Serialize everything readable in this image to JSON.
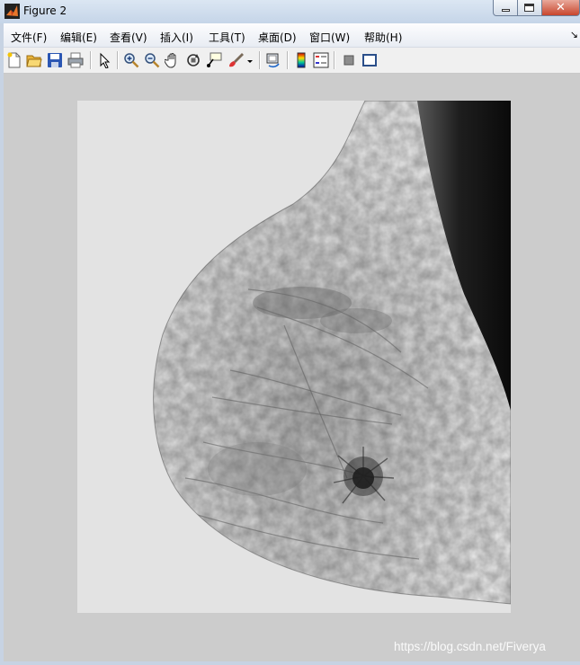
{
  "window": {
    "title": "Figure 2",
    "close_glyph": "✕"
  },
  "menu": {
    "items": [
      "文件(F)",
      "编辑(E)",
      "查看(V)",
      "插入(I)",
      "工具(T)",
      "桌面(D)",
      "窗口(W)",
      "帮助(H)"
    ],
    "overflow_glyph": "↘"
  },
  "toolbar": {
    "icons": [
      "new-figure-icon",
      "open-file-icon",
      "save-icon",
      "print-icon",
      "edit-plot-arrow-icon",
      "zoom-in-icon",
      "zoom-out-icon",
      "pan-hand-icon",
      "rotate-3d-icon",
      "data-cursor-icon",
      "brush-icon",
      "brush-dropdown-icon",
      "link-plot-icon",
      "colorbar-icon",
      "legend-icon",
      "hide-plot-tools-icon",
      "show-plot-tools-icon"
    ]
  },
  "figure": {
    "watermark": "https://blog.csdn.net/Fiverya"
  },
  "colors": {
    "figure_bg": "#cccccc",
    "image_bg": "#e3e3e3",
    "title_bar": "#cfdbea"
  }
}
